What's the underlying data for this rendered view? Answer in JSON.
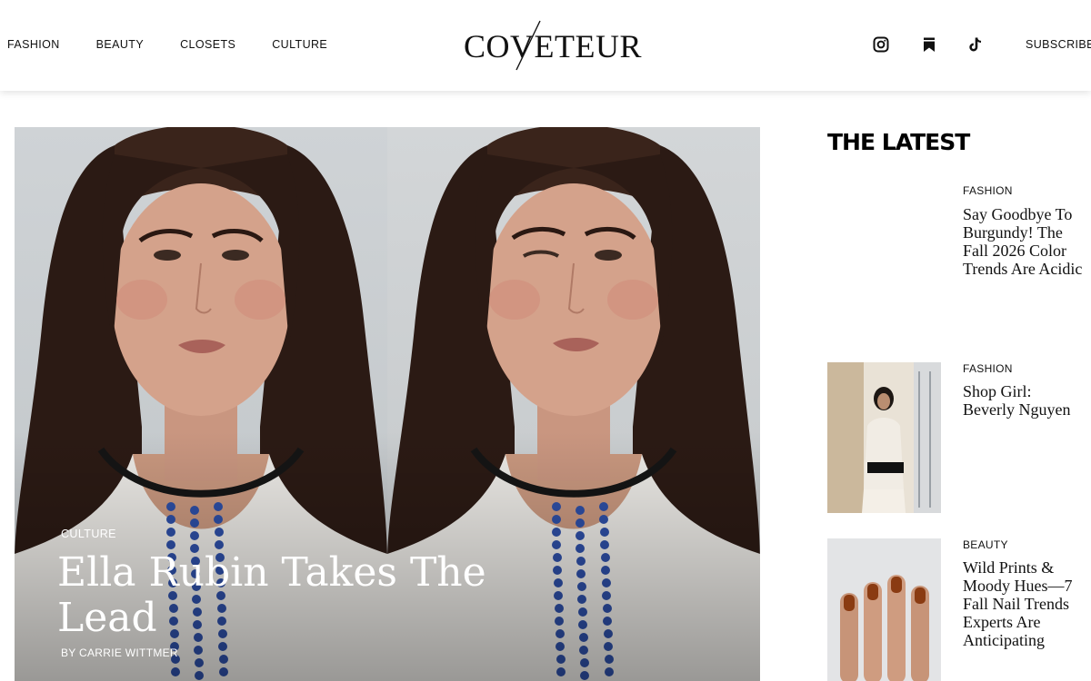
{
  "header": {
    "nav": [
      "FASHION",
      "BEAUTY",
      "CLOSETS",
      "CULTURE"
    ],
    "logo_text": "COVETEUR",
    "social_icons": [
      "instagram-icon",
      "bookmark-icon",
      "tiktok-icon"
    ],
    "subscribe_label": "SUBSCRIBE"
  },
  "hero": {
    "category": "CULTURE",
    "title": "Ella Rubin Takes The Lead",
    "byline": "BY CARRIE WITTMER"
  },
  "latest": {
    "heading": "THE LATEST",
    "items": [
      {
        "category": "FASHION",
        "title": "Say Goodbye To Burgundy! The Fall 2026 Color Trends Are Acidic"
      },
      {
        "category": "FASHION",
        "title": "Shop Girl: Beverly Nguyen"
      },
      {
        "category": "BEAUTY",
        "title": "Wild Prints & Moody Hues—7 Fall Nail Trends Experts Are Anticipating"
      }
    ]
  },
  "colors": {
    "text": "#111111",
    "background": "#ffffff",
    "nail_polish": "#8a3b12"
  }
}
